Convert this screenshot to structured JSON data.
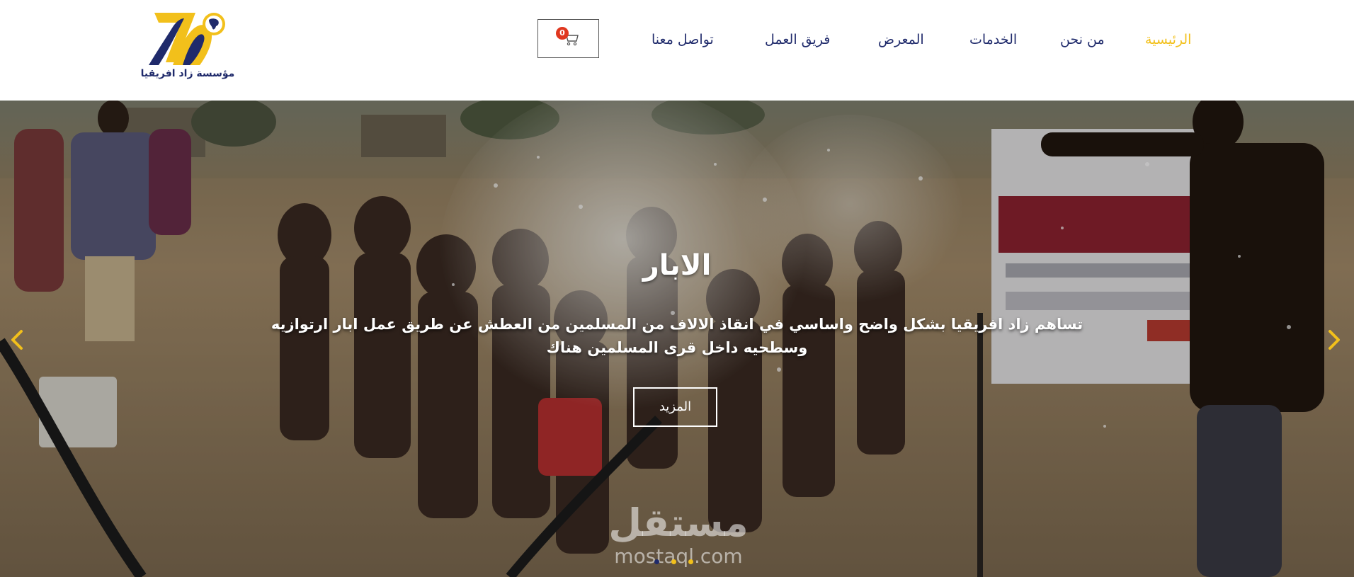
{
  "header": {
    "logo_text": "مؤسسة زاد افريقيا",
    "cart": {
      "count": "0"
    },
    "nav": [
      {
        "label": "الرئيسية",
        "active": true
      },
      {
        "label": "من نحن"
      },
      {
        "label": "الخدمات"
      },
      {
        "label": "المعرض"
      },
      {
        "label": "فريق العمل"
      },
      {
        "label": "تواصل معنا"
      }
    ]
  },
  "hero": {
    "title": "الابار",
    "text_line1": "تساهم زاد افريقيا بشكل واضح واساسي في انقاذ الالاف من المسلمين من العطش عن طريق عمل ابار ارتوازيه",
    "text_line2": "وسطحيه داخل قرى المسلمين هناك",
    "button": "المزيد",
    "slides_count": 3,
    "active_slide": 1
  },
  "watermark": {
    "arabic": "مستقل",
    "latin": "mostaql.com"
  },
  "colors": {
    "brand_navy": "#1f2a6b",
    "brand_yellow": "#f2c01b",
    "badge_red": "#e0371f"
  }
}
